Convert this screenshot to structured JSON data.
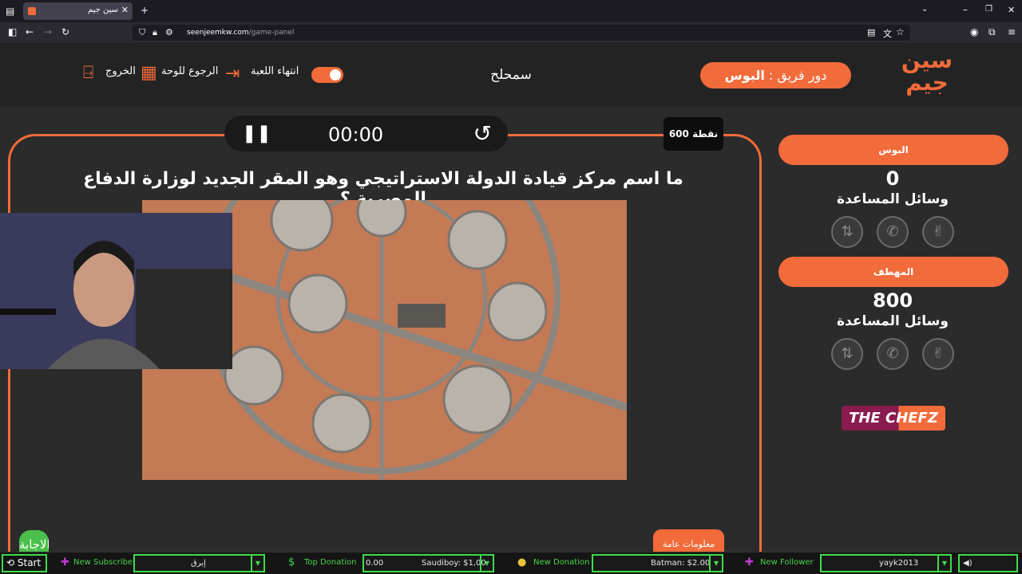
{
  "browser": {
    "tab_title": "سين جيم",
    "url_domain": "seenjeemkw.com",
    "url_path": "/game-panel"
  },
  "header": {
    "logo": "سين جيم",
    "turn_prefix": "دور فريق : ",
    "turn_team": "البوس",
    "current_player": "سمحلح",
    "end_game": "انتهاء اللعبة",
    "back_to_board": "الرجوع للوحة",
    "exit": "الخروج"
  },
  "question": {
    "points": "600 نقطة",
    "timer": "00:00",
    "text": "ما اسم مركز قيادة الدولة الاستراتيجي وهو المقر الجديد لوزارة الدفاع المصرية ؟",
    "answer_button": "الاجابة",
    "category": "معلومات عامة"
  },
  "teams": [
    {
      "name": "البوس",
      "score": "0",
      "aids_label": "وسائل المساعدة"
    },
    {
      "name": "المهطف",
      "score": "800",
      "aids_label": "وسائل المساعدة"
    }
  ],
  "aid_icons": [
    "swap-icon",
    "phone-icon",
    "hand-icon"
  ],
  "sponsor": "THE CHEFZ",
  "streambar": {
    "start": "Start",
    "new_subscriber": "New Subscriber",
    "subscriber_value": "إبرق",
    "top_donation": "Top Donation",
    "top_donation_amount": "0.00",
    "top_donation_value": "Saudiboy: $1,00",
    "new_donation": "New Donation",
    "donation_value": "Batman: $2.00",
    "new_follower": "New Follower",
    "follower_value": "yayk2013"
  },
  "colors": {
    "accent": "#f26b3a",
    "background": "#2b2b2b",
    "stream_green": "#3ddc4a"
  }
}
